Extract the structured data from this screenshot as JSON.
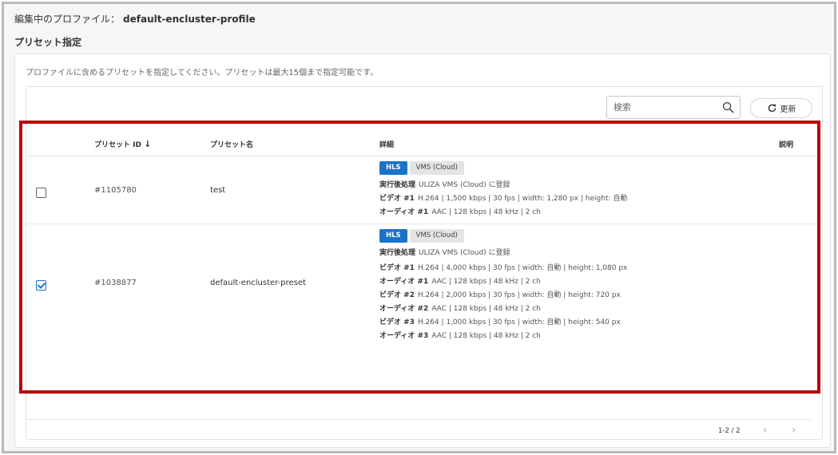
{
  "header": {
    "profile_label": "編集中のプロファイル：",
    "profile_name": "default-encluster-profile",
    "section_title": "プリセット指定"
  },
  "card": {
    "description": "プロファイルに含めるプリセットを指定してください。プリセットは最大15個まで指定可能です。"
  },
  "toolbar": {
    "search_placeholder": "検索",
    "refresh_label": "更新"
  },
  "table": {
    "columns": {
      "preset_id": "プリセット ID",
      "preset_name": "プリセット名",
      "detail": "詳細",
      "description": "説明"
    },
    "rows": [
      {
        "checked": false,
        "id": "#1105780",
        "name": "test",
        "badges": [
          "HLS",
          "VMS (Cloud)"
        ],
        "details": [
          {
            "k": "実行後処理",
            "v": "ULIZA VMS (Cloud) に登録"
          },
          {
            "k": "ビデオ #1",
            "v": "H.264 | 1,500 kbps | 30 fps | width: 1,280 px | height: 自動"
          },
          {
            "k": "オーディオ #1",
            "v": "AAC | 128 kbps | 48 kHz | 2 ch"
          }
        ]
      },
      {
        "checked": true,
        "id": "#1038877",
        "name": "default-encluster-preset",
        "badges": [
          "HLS",
          "VMS (Cloud)"
        ],
        "details": [
          {
            "k": "実行後処理",
            "v": "ULIZA VMS (Cloud) に登録"
          },
          {
            "k": "ビデオ #1",
            "v": "H.264 | 4,000 kbps | 30 fps | width: 自動 | height: 1,080 px"
          },
          {
            "k": "オーディオ #1",
            "v": "AAC | 128 kbps | 48 kHz | 2 ch"
          },
          {
            "k": "ビデオ #2",
            "v": "H.264 | 2,000 kbps | 30 fps | width: 自動 | height: 720 px"
          },
          {
            "k": "オーディオ #2",
            "v": "AAC | 128 kbps | 48 kHz | 2 ch"
          },
          {
            "k": "ビデオ #3",
            "v": "H.264 | 1,000 kbps | 30 fps | width: 自動 | height: 540 px"
          },
          {
            "k": "オーディオ #3",
            "v": "AAC | 128 kbps | 48 kHz | 2 ch"
          }
        ]
      }
    ]
  },
  "pager": {
    "text": "1-2 / 2",
    "prev": "‹",
    "next": "›"
  },
  "colors": {
    "accent": "#1a73c6",
    "highlight": "#b4000a"
  }
}
